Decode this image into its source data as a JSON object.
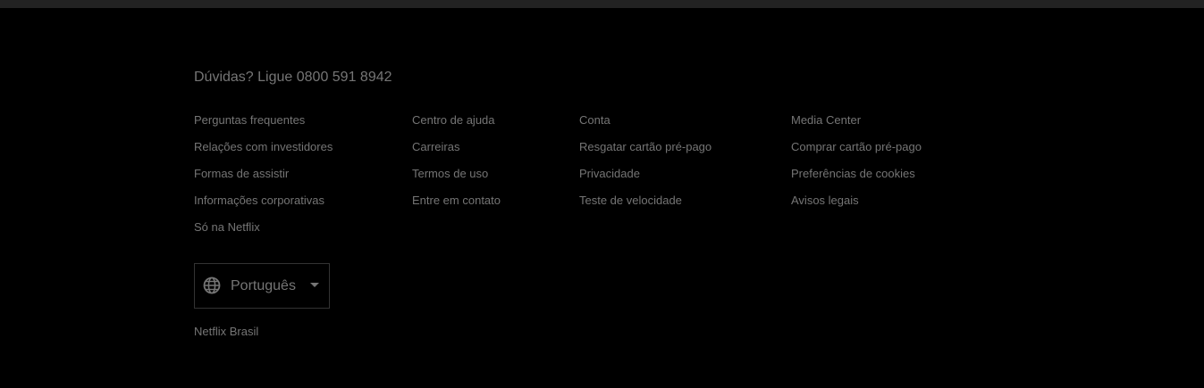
{
  "footer": {
    "phone_text": "Dúvidas? Ligue 0800 591 8942",
    "columns": [
      {
        "links": [
          "Perguntas frequentes",
          "Relações com investidores",
          "Formas de assistir",
          "Informações corporativas",
          "Só na Netflix"
        ]
      },
      {
        "links": [
          "Centro de ajuda",
          "Carreiras",
          "Termos de uso",
          "Entre em contato"
        ]
      },
      {
        "links": [
          "Conta",
          "Resgatar cartão pré-pago",
          "Privacidade",
          "Teste de velocidade"
        ]
      },
      {
        "links": [
          "Media Center",
          "Comprar cartão pré-pago",
          "Preferências de cookies",
          "Avisos legais"
        ]
      }
    ],
    "language_selector": {
      "selected": "Português",
      "icon": "globe-icon"
    },
    "country_label": "Netflix Brasil"
  },
  "colors": {
    "background": "#000000",
    "text": "#757575",
    "divider": "#222222",
    "border": "#333333"
  }
}
